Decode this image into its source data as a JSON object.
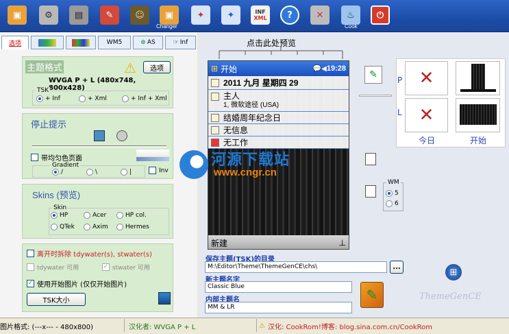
{
  "toolbar": {
    "buttons": [
      {
        "icon": "theme-icon"
      },
      {
        "icon": "settings-icon"
      },
      {
        "icon": "device-icon"
      },
      {
        "icon": "edit-icon"
      },
      {
        "icon": "mona-lisa-icon"
      },
      {
        "icon": "changer-icon"
      },
      {
        "icon": "paint-icon"
      },
      {
        "icon": "palette-icon"
      },
      {
        "icon": "inf-xml-icon"
      },
      {
        "icon": "help-icon"
      },
      {
        "icon": "tools-icon"
      },
      {
        "icon": "cookrom-icon"
      },
      {
        "icon": "power-icon"
      }
    ],
    "changer_label": "Changer",
    "inf_label": "INF",
    "xml_label": "XML",
    "cookrom_label": "Cook"
  },
  "tabs": [
    "选项",
    "",
    "",
    "WM5",
    "AS",
    "Inf"
  ],
  "theme_format": {
    "title": "主题格式",
    "resolution": "WVGA P + L (480x748, 800x428)",
    "options_button": "选项",
    "tsk_legend": "TSK",
    "tsk_options": [
      "+ Inf",
      "+ Xml",
      "+ Inf + Xml"
    ]
  },
  "stop_hint": {
    "title": "停止提示",
    "even_color_label": "带均匀色页面",
    "gradient_legend": "Gradient",
    "gradient_options": [
      "/",
      "\\",
      "|"
    ],
    "inv_label": "Inv"
  },
  "skins": {
    "title": "Skins (预览)",
    "legend": "Skin",
    "options": [
      "HP",
      "Acer",
      "HP col.",
      "QTek",
      "Axim",
      "Hermes"
    ]
  },
  "bottom_opts": {
    "remove_label": "离开时拆除 tdywater(s), stwater(s)",
    "tdywater_label": "tdywater 可用",
    "stwater_label": "stwater 可用",
    "use_start_label": "使用开始图片 (仅仅开始图片)",
    "tsk_size_button": "TSK大小"
  },
  "preview": {
    "click_hint": "点击此处预览",
    "start": "开始",
    "time": "19:28",
    "date": "2011 九月 星期四 29",
    "owner": "主人",
    "owner_sub": "1, 微软途径 (USA)",
    "anniversary": "结婚周年纪念日",
    "no_info": "无信息",
    "no_work": "无工作",
    "new_label": "新建"
  },
  "right": {
    "p_label": "P",
    "l_label": "L",
    "today_label": "今日",
    "start_label": "开始",
    "wm_legend": "WM",
    "wm_options": [
      "5",
      "6"
    ]
  },
  "save": {
    "dir_label": "保存主题(TSK)的目录",
    "dir_value": "M:\\Editor\\Theme\\ThemeGenCE\\chs\\",
    "browse": "...",
    "name_label": "新主题名字",
    "name_value": "Classic Blue",
    "internal_label": "内部主题名",
    "internal_value": "MM & LR"
  },
  "watermark": {
    "brand": "河源下载站",
    "url": "www.cngr.cn",
    "app": "ThemeGenCE"
  },
  "status": {
    "format": "图片格式: (---x--- - 480x800)",
    "translator": "汉化者: WVGA P + L",
    "credit": "汉化: CookRom!博客: blog.sina.com.cn/CookRom"
  },
  "colors": {
    "toolbar": "#1d4da8",
    "group_bg": "#d8ecd0",
    "accent_blue": "#1a3ca8"
  }
}
